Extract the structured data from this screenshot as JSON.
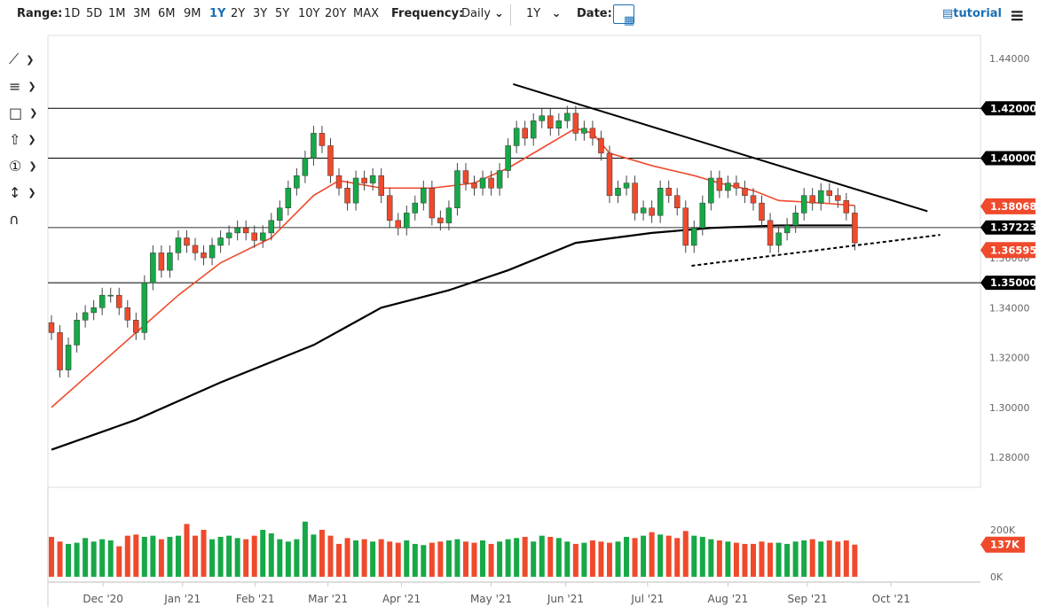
{
  "toolbar": {
    "range_label": "Range:",
    "ranges": [
      "1D",
      "5D",
      "1M",
      "3M",
      "6M",
      "9M",
      "1Y",
      "2Y",
      "3Y",
      "5Y",
      "10Y",
      "20Y",
      "MAX"
    ],
    "active_range": "1Y",
    "frequency_label": "Frequency:",
    "frequency_value": "Daily",
    "period_value": "1Y",
    "date_label": "Date:",
    "tutorial_label": "tutorial"
  },
  "drawing_tools": [
    "line-tool-icon",
    "fibonacci-tool-icon",
    "rectangle-tool-icon",
    "arrow-tool-icon",
    "annotation-tool-icon",
    "measure-tool-icon",
    "magnet-icon"
  ],
  "colors": {
    "up": "#17a847",
    "down": "#ef4a2c",
    "ma_fast": "#ef4a2c",
    "ma_slow": "#000000"
  },
  "chart_data": {
    "type": "candlestick",
    "ylim": [
      1.27,
      1.445
    ],
    "y_ticks": [
      "1.44000",
      "1.42000",
      "1.40000",
      "1.38000",
      "1.36000",
      "1.34000",
      "1.32000",
      "1.30000",
      "1.28000"
    ],
    "y_tick_values": [
      1.44,
      1.42,
      1.4,
      1.38,
      1.36,
      1.34,
      1.32,
      1.3,
      1.28
    ],
    "x_ticks": [
      {
        "label": "Dec '20",
        "i": 6.1
      },
      {
        "label": "Jan '21",
        "i": 15.5
      },
      {
        "label": "Feb '21",
        "i": 24.1
      },
      {
        "label": "Mar '21",
        "i": 32.7
      },
      {
        "label": "Apr '21",
        "i": 41.4
      },
      {
        "label": "May '21",
        "i": 52
      },
      {
        "label": "Jun '21",
        "i": 60.8
      },
      {
        "label": "Jul '21",
        "i": 70.5
      },
      {
        "label": "Aug '21",
        "i": 80
      },
      {
        "label": "Sep '21",
        "i": 89.4
      },
      {
        "label": "Oct '21",
        "i": 99.3
      }
    ],
    "closes": [
      1.33,
      1.315,
      1.325,
      1.335,
      1.338,
      1.34,
      1.345,
      1.345,
      1.34,
      1.335,
      1.33,
      1.35,
      1.362,
      1.355,
      1.362,
      1.368,
      1.365,
      1.362,
      1.36,
      1.365,
      1.368,
      1.37,
      1.372,
      1.37,
      1.367,
      1.37,
      1.375,
      1.38,
      1.388,
      1.393,
      1.4,
      1.41,
      1.405,
      1.393,
      1.388,
      1.382,
      1.392,
      1.39,
      1.393,
      1.385,
      1.375,
      1.372,
      1.378,
      1.382,
      1.388,
      1.376,
      1.374,
      1.38,
      1.395,
      1.39,
      1.388,
      1.392,
      1.388,
      1.395,
      1.405,
      1.412,
      1.408,
      1.415,
      1.417,
      1.412,
      1.415,
      1.418,
      1.41,
      1.412,
      1.408,
      1.402,
      1.385,
      1.388,
      1.39,
      1.378,
      1.38,
      1.377,
      1.388,
      1.385,
      1.38,
      1.365,
      1.372,
      1.382,
      1.392,
      1.387,
      1.39,
      1.388,
      1.385,
      1.382,
      1.375,
      1.365,
      1.37,
      1.373,
      1.378,
      1.385,
      1.382,
      1.387,
      1.385,
      1.383,
      1.378,
      1.366
    ],
    "ma_fast": [
      [
        0,
        1.3
      ],
      [
        5,
        1.315
      ],
      [
        10,
        1.33
      ],
      [
        15,
        1.345
      ],
      [
        20,
        1.358
      ],
      [
        26,
        1.368
      ],
      [
        31,
        1.385
      ],
      [
        34,
        1.391
      ],
      [
        39,
        1.388
      ],
      [
        45,
        1.388
      ],
      [
        50,
        1.39
      ],
      [
        54,
        1.396
      ],
      [
        58,
        1.404
      ],
      [
        62,
        1.412
      ],
      [
        64,
        1.41
      ],
      [
        66,
        1.402
      ],
      [
        71,
        1.397
      ],
      [
        76,
        1.393
      ],
      [
        79,
        1.39
      ],
      [
        83,
        1.387
      ],
      [
        86,
        1.383
      ],
      [
        91,
        1.382
      ],
      [
        95,
        1.381
      ]
    ],
    "ma_slow": [
      [
        0,
        1.283
      ],
      [
        10,
        1.295
      ],
      [
        20,
        1.31
      ],
      [
        31,
        1.325
      ],
      [
        39,
        1.34
      ],
      [
        47,
        1.347
      ],
      [
        54,
        1.355
      ],
      [
        62,
        1.366
      ],
      [
        71,
        1.37
      ],
      [
        78,
        1.372
      ],
      [
        86,
        1.373
      ],
      [
        95,
        1.373
      ]
    ],
    "trendline_resistance": [
      [
        54.6,
        1.4297
      ],
      [
        103.6,
        1.3787
      ]
    ],
    "trendline_support": [
      [
        75.7,
        1.3568
      ],
      [
        105.1,
        1.3692
      ]
    ],
    "horizontal_levels": [
      {
        "value": 1.42,
        "label": "1.42000"
      },
      {
        "value": 1.4,
        "label": "1.40000"
      },
      {
        "value": 1.3722,
        "label": "1.37223"
      },
      {
        "value": 1.35,
        "label": "1.35000"
      }
    ],
    "price_badges": [
      {
        "value": 1.38068,
        "label": "1.38068",
        "color": "#ef4a2c"
      },
      {
        "value": 1.36595,
        "label": "1.36595",
        "color": "#ef4a2c"
      }
    ],
    "volume": {
      "ylim": [
        0,
        260
      ],
      "y_ticks": [
        "200K",
        "0K"
      ],
      "last_label": "137K",
      "values": [
        170,
        150,
        140,
        145,
        165,
        150,
        160,
        155,
        130,
        175,
        180,
        170,
        175,
        160,
        170,
        175,
        225,
        175,
        200,
        160,
        170,
        175,
        165,
        160,
        175,
        200,
        185,
        160,
        150,
        160,
        235,
        180,
        200,
        175,
        140,
        165,
        155,
        160,
        150,
        160,
        150,
        145,
        155,
        140,
        135,
        145,
        150,
        155,
        160,
        150,
        145,
        155,
        140,
        150,
        160,
        165,
        170,
        150,
        175,
        170,
        165,
        150,
        140,
        145,
        155,
        150,
        145,
        150,
        170,
        165,
        175,
        190,
        180,
        175,
        165,
        195,
        175,
        170,
        160,
        155,
        150,
        145,
        140,
        140,
        150,
        145,
        145,
        140,
        150,
        155,
        160,
        150,
        155,
        150,
        155,
        137
      ]
    }
  }
}
